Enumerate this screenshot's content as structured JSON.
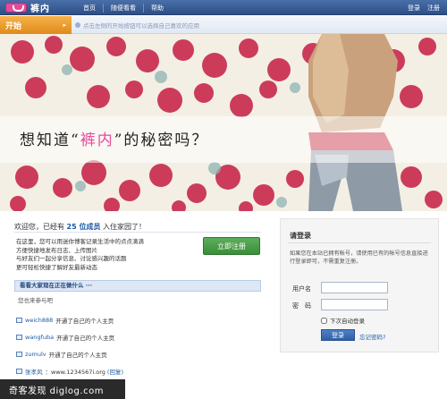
{
  "topbar": {
    "brand": "裤内",
    "nav": [
      "首页",
      "随便看看",
      "帮助"
    ],
    "auth": [
      "登录",
      "注册"
    ]
  },
  "startbar": {
    "start_label": "开始",
    "hint": "点击左侧的开始按钮可以选择自己喜欢的应用"
  },
  "banner": {
    "slogan_pre": "想知道“",
    "slogan_hl": "裤内",
    "slogan_post": "”的秘密吗？"
  },
  "welcome": {
    "pre": "欢迎您，已经有",
    "count": "25 位成员",
    "post": "入住家园了！"
  },
  "intro": {
    "line1": "在这里，您可以用迷你博客记录生活中的点点滴滴",
    "line2": "方便快捷地发布日志、上传图片",
    "line3": "与好友们一起分享信息、讨论感兴趣的话题",
    "line4": "更可轻松快捷了解好友最新动态"
  },
  "register_button": "立即注册",
  "feed": {
    "heading": "看看大家现在正在做什么 ···",
    "subheading": "您也来参与吧",
    "items": [
      {
        "user": "weich888",
        "text": "开通了自己的个人主页"
      },
      {
        "user": "wangfuba",
        "text": "开通了自己的个人主页"
      },
      {
        "user": "zumulv",
        "text": "开通了自己的个人主页"
      },
      {
        "user": "张孝风",
        "text": "：www.1234567i.org",
        "reply": "(回复)"
      }
    ]
  },
  "login": {
    "title": "请登录",
    "desc": "如果您在本站已拥有帐号，请使用已有的帐号信息直接进行登录即可，不需重复注册。",
    "username_label": "用户名",
    "password_label": "密　码",
    "remember_label": "下次自动登录",
    "submit_label": "登录",
    "forgot_label": "忘记密码?"
  },
  "watermark": "奇客发现 diglog.com",
  "colors": {
    "topbar": "#2d4f86",
    "start": "#e08a1a",
    "accent_pink": "#e54d9c",
    "link": "#1b5aa6",
    "register": "#3c8d3a"
  }
}
